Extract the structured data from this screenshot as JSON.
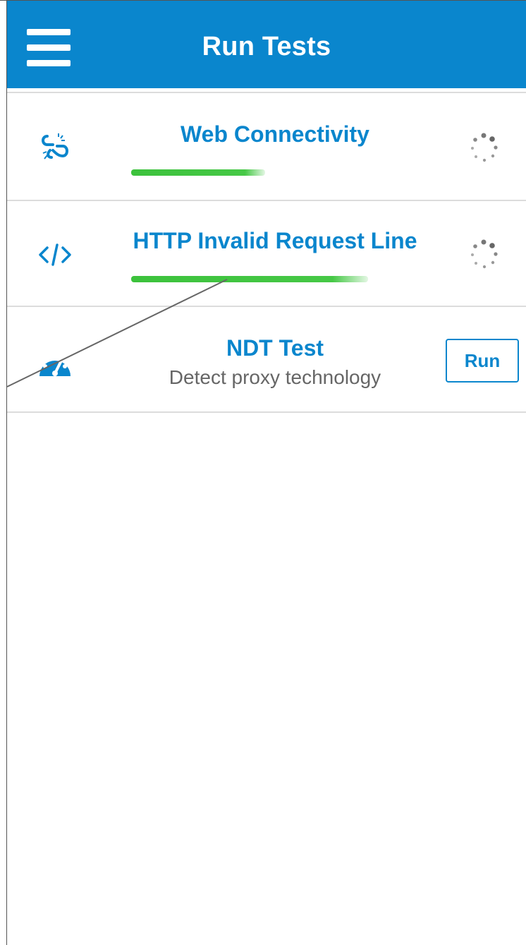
{
  "header": {
    "title": "Run Tests",
    "menu_icon": "hamburger-menu-icon",
    "background": "#0a86cd"
  },
  "tests": [
    {
      "title": "Web Connectivity",
      "icon": "broken-link-icon",
      "status": "running",
      "progress": 0.4
    },
    {
      "title": "HTTP Invalid Request Line",
      "icon": "code-icon",
      "status": "running",
      "progress": 0.7
    },
    {
      "title": "NDT Test",
      "subtitle": "Detect proxy technology",
      "icon": "speedometer-icon",
      "status": "idle",
      "run_label": "Run"
    }
  ],
  "colors": {
    "accent": "#0a86cd",
    "progress": "#46c846",
    "divider": "#dcdcdc"
  }
}
